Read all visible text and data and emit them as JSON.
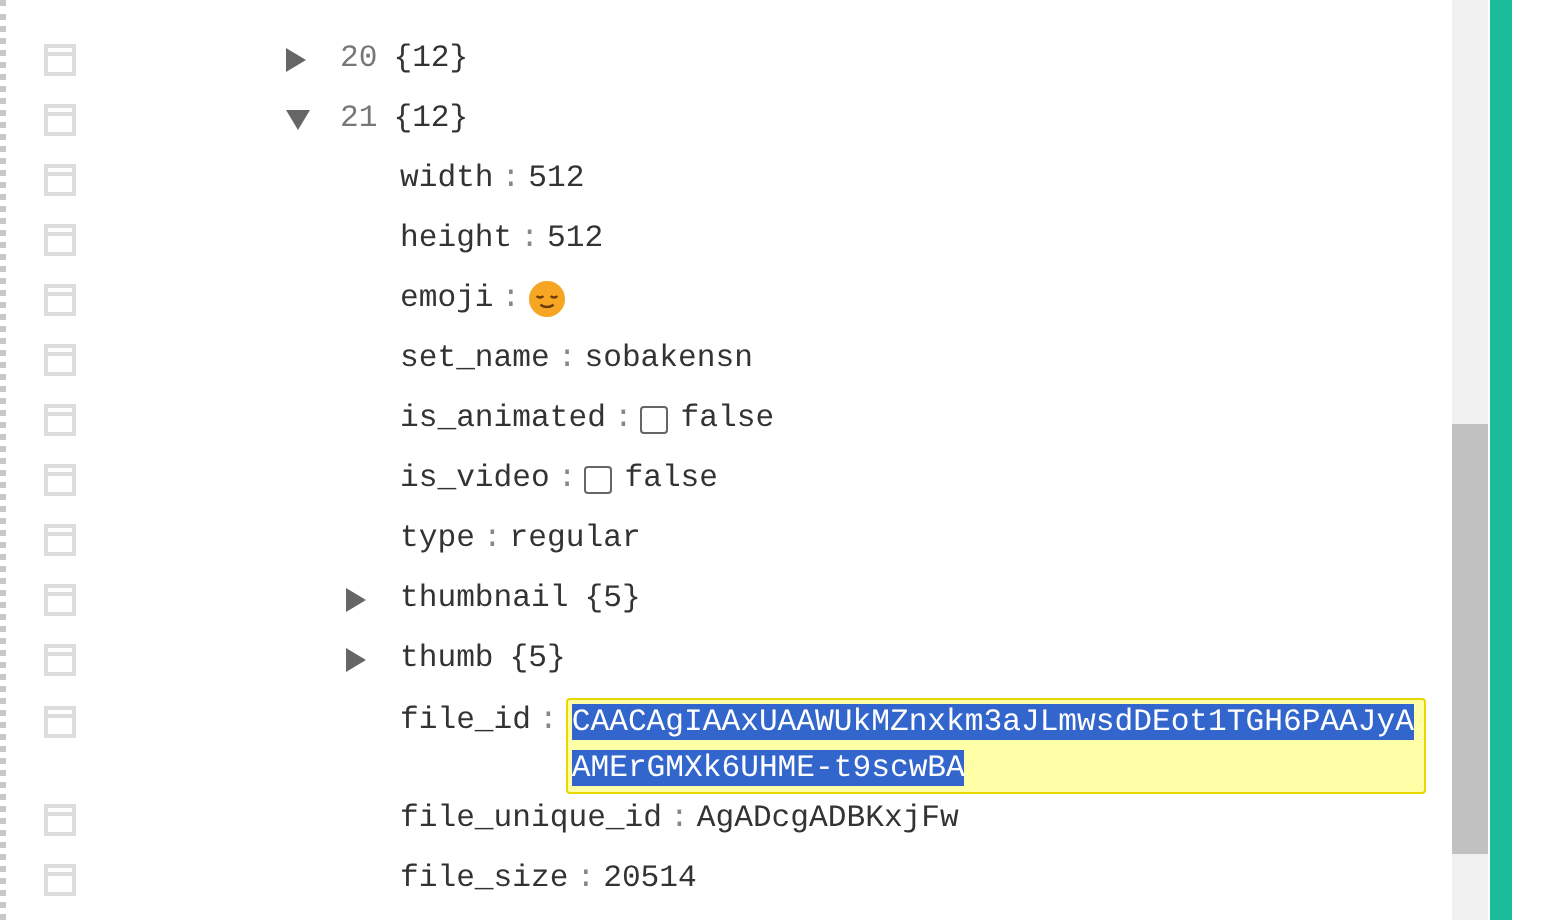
{
  "separator": ":",
  "items": [
    {
      "index": "20",
      "count": "{12}",
      "expanded": false
    },
    {
      "index": "21",
      "count": "{12}",
      "expanded": true,
      "children": [
        {
          "key": "width",
          "kind": "text",
          "value": "512"
        },
        {
          "key": "height",
          "kind": "text",
          "value": "512"
        },
        {
          "key": "emoji",
          "kind": "emoji"
        },
        {
          "key": "set_name",
          "kind": "text",
          "value": "sobakensn"
        },
        {
          "key": "is_animated",
          "kind": "bool",
          "checked": false,
          "value": "false"
        },
        {
          "key": "is_video",
          "kind": "bool",
          "checked": false,
          "value": "false"
        },
        {
          "key": "type",
          "kind": "text",
          "value": "regular"
        },
        {
          "key": "thumbnail",
          "kind": "object",
          "count": "{5}",
          "expanded": false
        },
        {
          "key": "thumb",
          "kind": "object",
          "count": "{5}",
          "expanded": false
        },
        {
          "key": "file_id",
          "kind": "edit",
          "selected": true,
          "value": "CAACAgIAAxUAAWUkMZnxkm3aJLmwsdDEot1TGH6PAAJyAAMErGMXk6UHME-t9scwBA"
        },
        {
          "key": "file_unique_id",
          "kind": "text",
          "value": "AgADcgADBKxjFw"
        },
        {
          "key": "file_size",
          "kind": "text",
          "value": "20514"
        }
      ]
    }
  ]
}
